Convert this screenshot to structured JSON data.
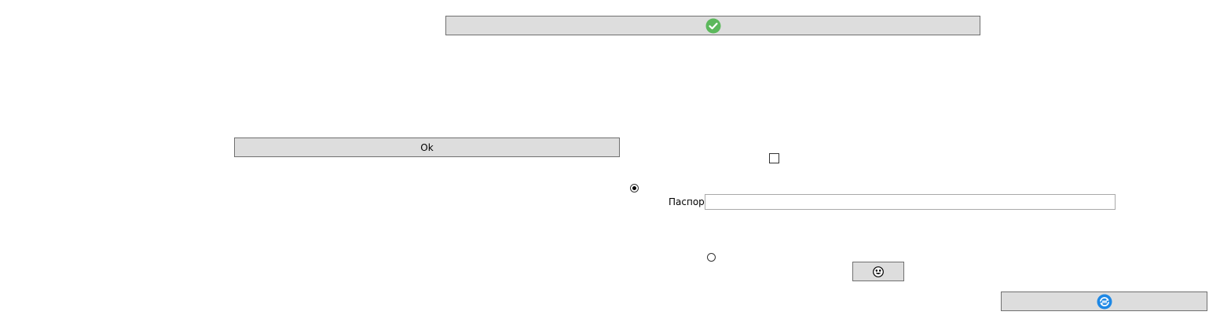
{
  "toolbar": {
    "top_button_icon": "check-circle-icon",
    "ok_label": "Ok",
    "face_button_icon": "smiley-face-icon",
    "bottom_button_icon": "refresh-cycle-icon"
  },
  "form": {
    "passport_label": "Паспорт",
    "passport_value": "",
    "checkbox_checked": false,
    "radio_1_selected": true,
    "radio_2_selected": false
  },
  "colors": {
    "button_bg": "#dddddd",
    "button_border": "#707070",
    "check_green": "#5cb85c",
    "refresh_blue": "#1e88e5"
  }
}
